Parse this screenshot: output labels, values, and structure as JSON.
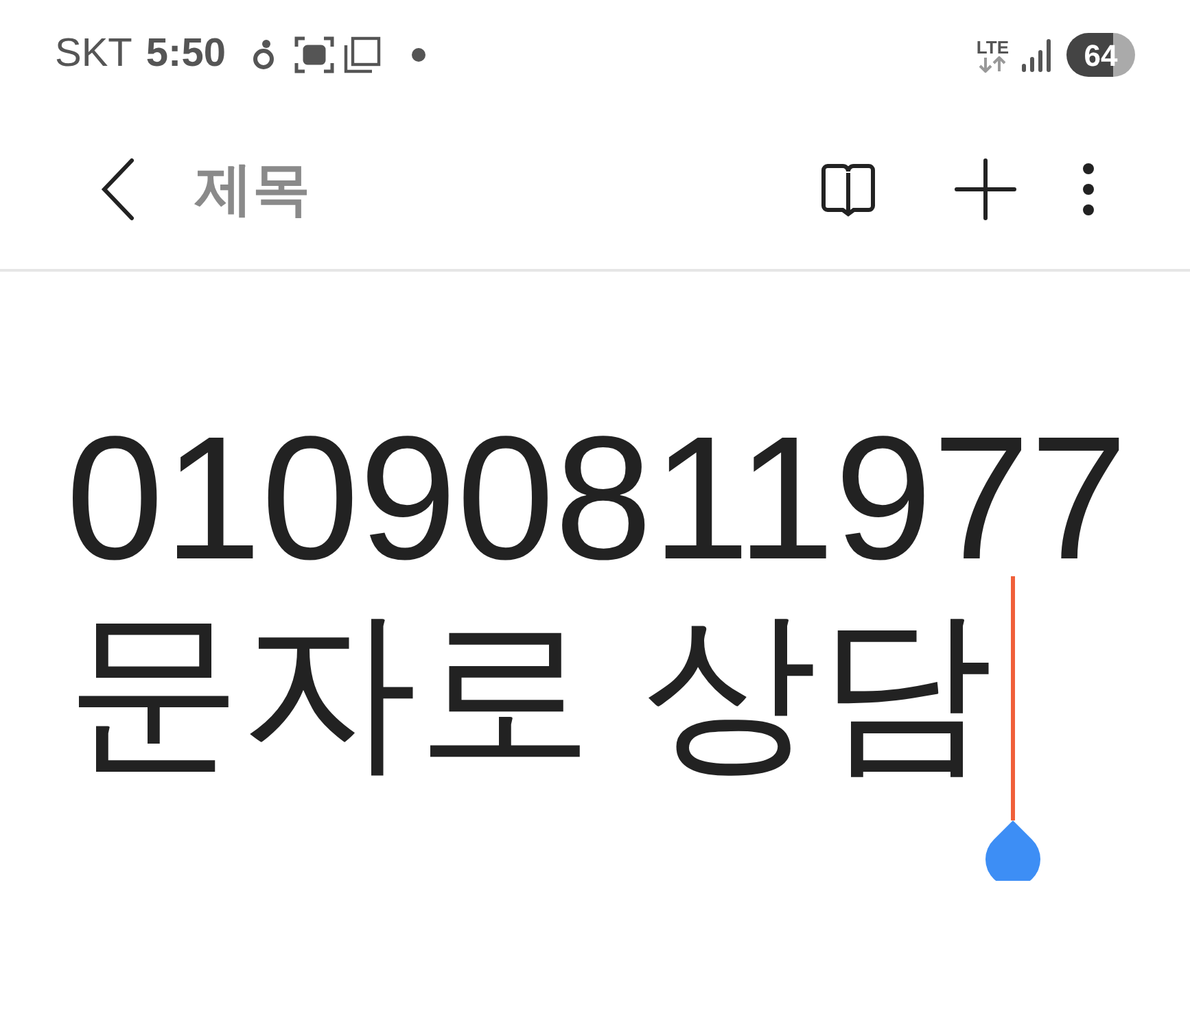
{
  "status_bar": {
    "carrier": "SKT",
    "time": "5:50",
    "network": "LTE",
    "battery": "64"
  },
  "toolbar": {
    "title": {
      "placeholder": "제목"
    }
  },
  "note": {
    "lines": [
      "01090811977",
      "문자로 상담"
    ]
  }
}
